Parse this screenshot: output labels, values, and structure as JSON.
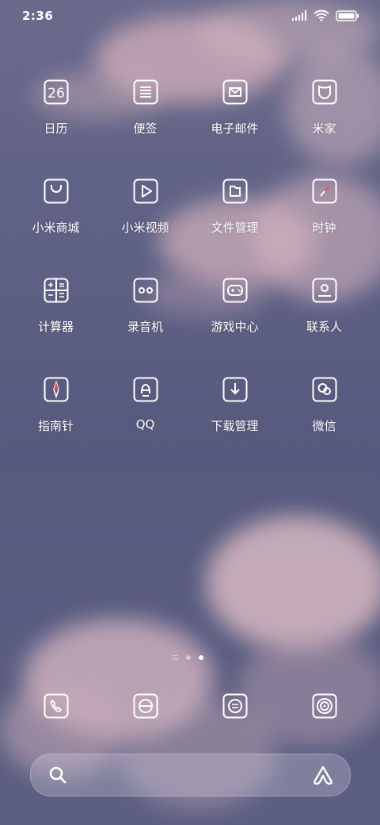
{
  "status": {
    "time": "2:36"
  },
  "apps": [
    {
      "label": "日历",
      "icon": "calendar-icon",
      "date": "26"
    },
    {
      "label": "便签",
      "icon": "notes-icon"
    },
    {
      "label": "电子邮件",
      "icon": "mail-icon"
    },
    {
      "label": "米家",
      "icon": "mijia-icon"
    },
    {
      "label": "小米商城",
      "icon": "shop-bag-icon"
    },
    {
      "label": "小米视频",
      "icon": "video-play-icon"
    },
    {
      "label": "文件管理",
      "icon": "folder-icon"
    },
    {
      "label": "时钟",
      "icon": "clock-icon"
    },
    {
      "label": "计算器",
      "icon": "calculator-icon"
    },
    {
      "label": "录音机",
      "icon": "recorder-icon"
    },
    {
      "label": "游戏中心",
      "icon": "gamepad-icon"
    },
    {
      "label": "联系人",
      "icon": "contacts-icon"
    },
    {
      "label": "指南针",
      "icon": "compass-icon"
    },
    {
      "label": "QQ",
      "icon": "qq-icon"
    },
    {
      "label": "下载管理",
      "icon": "download-icon"
    },
    {
      "label": "微信",
      "icon": "wechat-icon"
    }
  ],
  "dock": [
    {
      "icon": "phone-icon"
    },
    {
      "icon": "browser-icon"
    },
    {
      "icon": "messages-icon"
    },
    {
      "icon": "camera-icon"
    }
  ],
  "pages": {
    "count": 2,
    "active": 2
  },
  "colors": {
    "wallpaper": "#5a5c80",
    "cloud": "#d9b6bd",
    "icon_stroke": "#ffffff"
  }
}
